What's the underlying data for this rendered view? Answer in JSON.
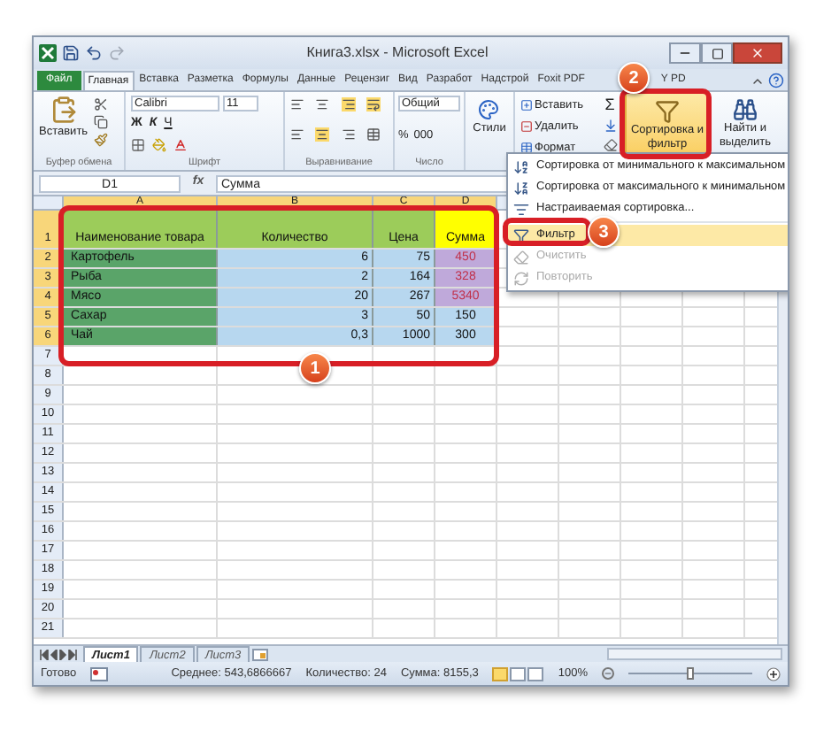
{
  "window": {
    "title": "Книга3.xlsx - Microsoft Excel"
  },
  "ribbon_tabs": [
    {
      "label": "Файл",
      "kind": "file",
      "selected": false
    },
    {
      "label": "Главная",
      "kind": "tab",
      "selected": true
    },
    {
      "label": "Вставка",
      "kind": "tab",
      "selected": false
    },
    {
      "label": "Разметка",
      "kind": "tab",
      "selected": false
    },
    {
      "label": "Формулы",
      "kind": "tab",
      "selected": false
    },
    {
      "label": "Данные",
      "kind": "tab",
      "selected": false
    },
    {
      "label": "Рецензиг",
      "kind": "tab",
      "selected": false
    },
    {
      "label": "Вид",
      "kind": "tab",
      "selected": false
    },
    {
      "label": "Разработ",
      "kind": "tab",
      "selected": false
    },
    {
      "label": "Надстрой",
      "kind": "tab",
      "selected": false
    },
    {
      "label": "Foxit PDF",
      "kind": "tab",
      "selected": false
    },
    {
      "label": "Y PD",
      "kind": "tab",
      "selected": false
    }
  ],
  "ribbon": {
    "clipboard": {
      "paste": "Вставить",
      "label": "Буфер обмена"
    },
    "font": {
      "name": "Calibri",
      "size": "11",
      "styles": [
        "Ж",
        "К",
        "Ч"
      ],
      "label": "Шрифт"
    },
    "alignment": {
      "label": "Выравнивание"
    },
    "number": {
      "format": "Общий",
      "percent": "%",
      "thousands": "000",
      "label": "Число"
    },
    "styles": {
      "button": "Стили"
    },
    "cells": {
      "items": [
        "Вставить",
        "Удалить",
        "Формат"
      ]
    },
    "editing": {
      "sum": "Σ",
      "sort_filter": {
        "label": "Сортировка и фильтр",
        "selected": true
      },
      "find": "Найти и выделить"
    }
  },
  "formula_bar": {
    "name_box": "D1",
    "function_label": "fx",
    "value": "Сумма"
  },
  "sheet": {
    "columns": [
      {
        "label": "A",
        "selected": true
      },
      {
        "label": "B",
        "selected": true
      },
      {
        "label": "C",
        "selected": true
      },
      {
        "label": "D",
        "selected": true
      }
    ],
    "rows": [
      {
        "number": "1",
        "selected": true,
        "cells": [
          {
            "text": "Наименование товара",
            "kind": "header",
            "color": "#9ccc5a"
          },
          {
            "text": "Количество",
            "kind": "header",
            "color": "#9ccc5a"
          },
          {
            "text": "Цена",
            "kind": "header",
            "color": "#9ccc5a"
          },
          {
            "text": "Сумма",
            "kind": "header",
            "color": "#ffff00"
          }
        ]
      },
      {
        "number": "2",
        "selected": true,
        "cells": [
          {
            "text": "Картофель",
            "kind": "text",
            "color": "#5aa469"
          },
          {
            "text": "6",
            "kind": "number",
            "color": "#b7d7ef"
          },
          {
            "text": "75",
            "kind": "number",
            "color": "#b7d7ef"
          },
          {
            "text": "450",
            "kind": "flagged",
            "color": "#bfa9da"
          }
        ]
      },
      {
        "number": "3",
        "selected": true,
        "cells": [
          {
            "text": "Рыба",
            "kind": "text",
            "color": "#5aa469"
          },
          {
            "text": "2",
            "kind": "number",
            "color": "#b7d7ef"
          },
          {
            "text": "164",
            "kind": "number",
            "color": "#b7d7ef"
          },
          {
            "text": "328",
            "kind": "flagged",
            "color": "#bfa9da"
          }
        ]
      },
      {
        "number": "4",
        "selected": true,
        "cells": [
          {
            "text": "Мясо",
            "kind": "text",
            "color": "#5aa469"
          },
          {
            "text": "20",
            "kind": "number",
            "color": "#b7d7ef"
          },
          {
            "text": "267",
            "kind": "number",
            "color": "#b7d7ef"
          },
          {
            "text": "5340",
            "kind": "flagged",
            "color": "#bfa9da"
          }
        ]
      },
      {
        "number": "5",
        "selected": true,
        "cells": [
          {
            "text": "Сахар",
            "kind": "text",
            "color": "#5aa469"
          },
          {
            "text": "3",
            "kind": "number",
            "color": "#b7d7ef"
          },
          {
            "text": "50",
            "kind": "number",
            "color": "#b7d7ef"
          },
          {
            "text": "150",
            "kind": "sum",
            "color": "#b7d7ef"
          }
        ]
      },
      {
        "number": "6",
        "selected": true,
        "cells": [
          {
            "text": "Чай",
            "kind": "text",
            "color": "#5aa469"
          },
          {
            "text": "0,3",
            "kind": "number",
            "color": "#b7d7ef"
          },
          {
            "text": "1000",
            "kind": "number",
            "color": "#b7d7ef"
          },
          {
            "text": "300",
            "kind": "sum",
            "color": "#b7d7ef"
          }
        ]
      },
      {
        "number": "7",
        "selected": false
      },
      {
        "number": "8",
        "selected": false
      },
      {
        "number": "9",
        "selected": false
      },
      {
        "number": "10",
        "selected": false
      },
      {
        "number": "11",
        "selected": false
      },
      {
        "number": "12",
        "selected": false
      },
      {
        "number": "13",
        "selected": false
      },
      {
        "number": "14",
        "selected": false
      },
      {
        "number": "15",
        "selected": false
      },
      {
        "number": "16",
        "selected": false
      },
      {
        "number": "17",
        "selected": false
      },
      {
        "number": "18",
        "selected": false
      },
      {
        "number": "19",
        "selected": false
      },
      {
        "number": "20",
        "selected": false
      },
      {
        "number": "21",
        "selected": false
      }
    ]
  },
  "menu": {
    "items": [
      {
        "label": "Сортировка от минимального к максимальном",
        "kind": "sort_asc",
        "disabled": false,
        "selected": false
      },
      {
        "label": "Сортировка от максимального к минимальном",
        "kind": "sort_desc",
        "disabled": false,
        "selected": false
      },
      {
        "label": "Настраиваемая сортировка...",
        "kind": "custom",
        "disabled": false,
        "selected": false
      },
      {
        "label": "Фильтр",
        "kind": "filter",
        "disabled": false,
        "selected": true
      },
      {
        "label": "Очистить",
        "kind": "clear",
        "disabled": true,
        "selected": false
      },
      {
        "label": "Повторить",
        "kind": "reapply",
        "disabled": true,
        "selected": false
      }
    ]
  },
  "sheet_tabs": [
    {
      "label": "Лист1",
      "selected": true
    },
    {
      "label": "Лист2",
      "selected": false
    },
    {
      "label": "Лист3",
      "selected": false
    }
  ],
  "status_bar": {
    "ready": "Готово",
    "average": "Среднее: 543,6866667",
    "count": "Количество: 24",
    "sum": "Сумма: 8155,3",
    "zoom": "100%",
    "zoom_slider": {
      "level": 0.5
    }
  },
  "annotations": [
    {
      "label": "1"
    },
    {
      "label": "2"
    },
    {
      "label": "3"
    }
  ]
}
